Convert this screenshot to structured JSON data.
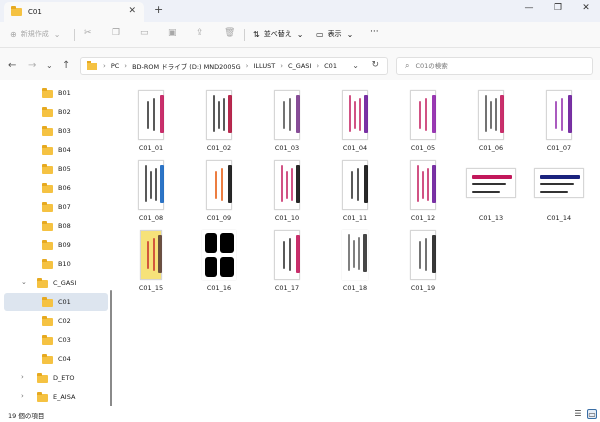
{
  "window": {
    "tab_title": "C01",
    "tab_close": "✕",
    "new_tab": "+",
    "minimize": "—",
    "maximize": "❐",
    "close": "✕"
  },
  "commands": {
    "new_label": "新規作成",
    "sort_label": "並べ替え",
    "view_label": "表示",
    "more": "···"
  },
  "address": {
    "crumbs": [
      "PC",
      "BD-ROM ドライブ (D:) MND2005G",
      "ILLUST",
      "C_GASI",
      "C01"
    ]
  },
  "search": {
    "placeholder": "C01の検索"
  },
  "sidebar": {
    "items": [
      {
        "label": "B01"
      },
      {
        "label": "B02"
      },
      {
        "label": "B03"
      },
      {
        "label": "B04"
      },
      {
        "label": "B05"
      },
      {
        "label": "B06"
      },
      {
        "label": "B07"
      },
      {
        "label": "B08"
      },
      {
        "label": "B09"
      },
      {
        "label": "B10"
      },
      {
        "label": "C_GASI"
      },
      {
        "label": "C01"
      },
      {
        "label": "C02"
      },
      {
        "label": "C03"
      },
      {
        "label": "C04"
      },
      {
        "label": "D_ETO"
      },
      {
        "label": "E_AISA"
      }
    ]
  },
  "files": [
    {
      "name": "C01_01"
    },
    {
      "name": "C01_02"
    },
    {
      "name": "C01_03"
    },
    {
      "name": "C01_04"
    },
    {
      "name": "C01_05"
    },
    {
      "name": "C01_06"
    },
    {
      "name": "C01_07"
    },
    {
      "name": "C01_08"
    },
    {
      "name": "C01_09"
    },
    {
      "name": "C01_10"
    },
    {
      "name": "C01_11"
    },
    {
      "name": "C01_12"
    },
    {
      "name": "C01_13"
    },
    {
      "name": "C01_14"
    },
    {
      "name": "C01_15"
    },
    {
      "name": "C01_16"
    },
    {
      "name": "C01_17"
    },
    {
      "name": "C01_18"
    },
    {
      "name": "C01_19"
    }
  ],
  "status": {
    "item_count": "19 個の項目"
  },
  "colors": {
    "folder": "#f5c242",
    "selection": "#dde5ef",
    "accent": "#3a6ea5"
  }
}
